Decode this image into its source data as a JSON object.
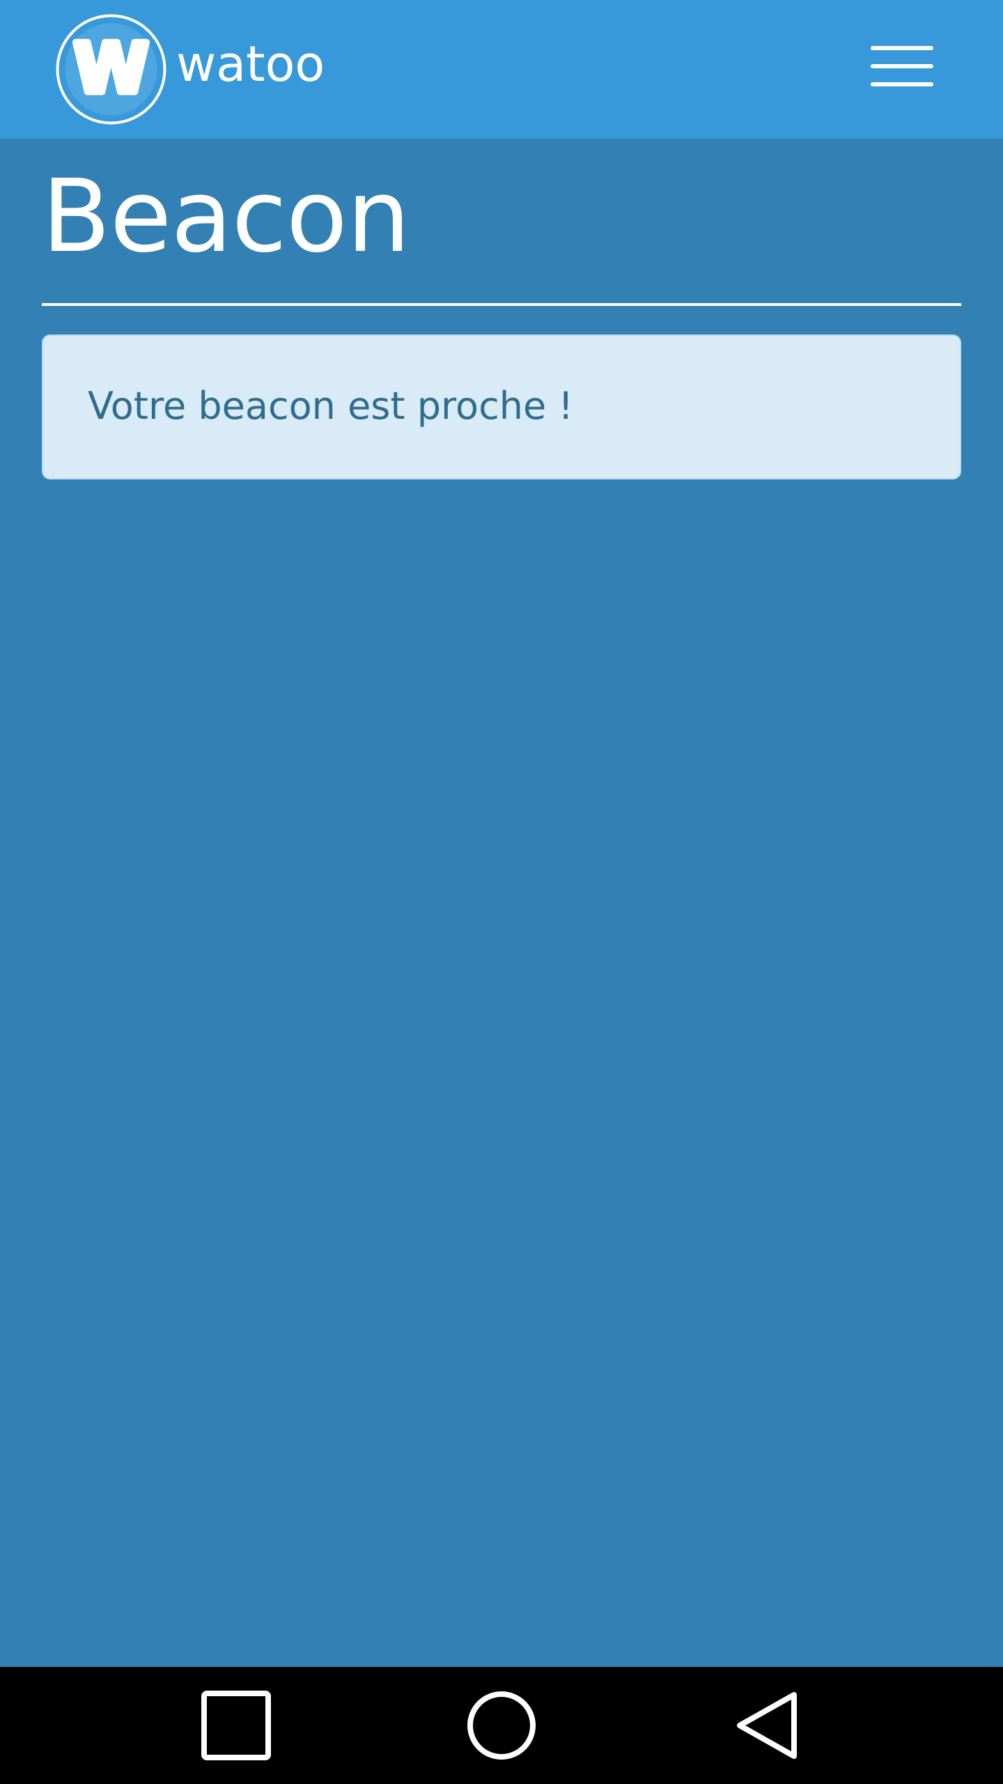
{
  "header": {
    "brand_name": "watoo",
    "logo_letter": "W",
    "logo_icon": "watoo-logo",
    "menu_icon": "hamburger-menu-icon"
  },
  "main": {
    "page_title": "Beacon",
    "alert_message": "Votre beacon est proche !"
  },
  "nav_bar": {
    "recents_icon": "square-icon",
    "home_icon": "circle-icon",
    "back_icon": "triangle-back-icon"
  },
  "colors": {
    "header_bg": "#3899da",
    "page_bg": "#3381b4",
    "alert_bg": "#d9ebf6",
    "alert_text": "#2f6d8f",
    "nav_bg": "#000000"
  }
}
